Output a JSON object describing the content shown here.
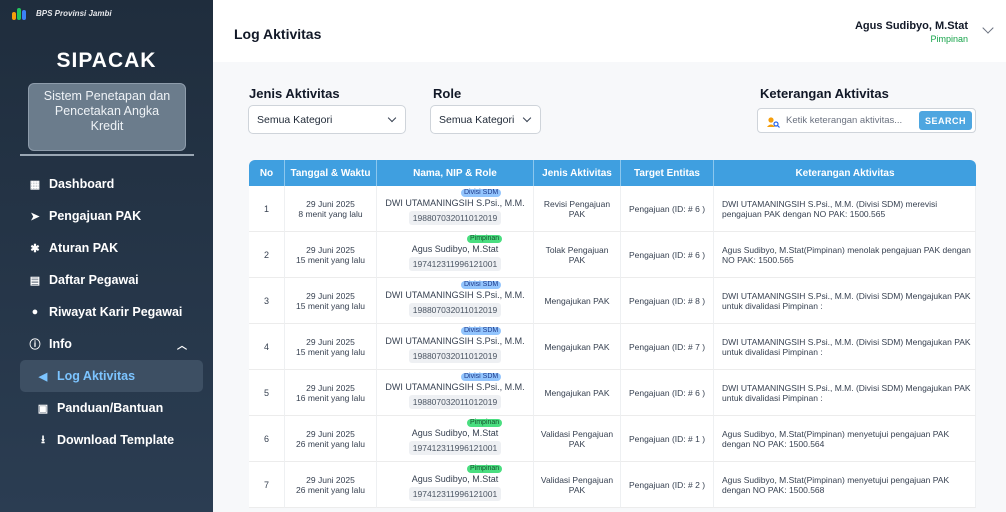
{
  "sidebar": {
    "org_name": "BPS Provinsi Jambi",
    "app_title": "SIPACAK",
    "app_subtitle": "Sistem Penetapan dan Pencetakan Angka Kredit",
    "items": [
      {
        "label": "Dashboard",
        "icon": "grid-icon"
      },
      {
        "label": "Pengajuan PAK",
        "icon": "send-icon"
      },
      {
        "label": "Aturan PAK",
        "icon": "gear-icon"
      },
      {
        "label": "Daftar Pegawai",
        "icon": "list-icon"
      },
      {
        "label": "Riwayat Karir Pegawai",
        "icon": "users-icon"
      },
      {
        "label": "Info",
        "icon": "info-icon"
      },
      {
        "label": "Log Aktivitas",
        "icon": "megaphone-icon"
      },
      {
        "label": "Panduan/Bantuan",
        "icon": "book-icon"
      },
      {
        "label": "Download Template",
        "icon": "download-icon"
      }
    ]
  },
  "header": {
    "page_title": "Log Aktivitas",
    "user_name": "Agus Sudibyo, M.Stat",
    "user_role": "Pimpinan"
  },
  "filters": {
    "jenis_label": "Jenis Aktivitas",
    "jenis_value": "Semua Kategori",
    "role_label": "Role",
    "role_value": "Semua Kategori",
    "ket_label": "Keterangan Aktivitas",
    "search_placeholder": "Ketik keterangan aktivitas...",
    "search_button": "SEARCH"
  },
  "table": {
    "headers": [
      "No",
      "Tanggal & Waktu",
      "Nama, NIP & Role",
      "Jenis Aktivitas",
      "Target Entitas",
      "Keterangan Aktivitas"
    ],
    "rows": [
      {
        "no": "1",
        "date": "29 Juni 2025",
        "ago": "8 menit yang lalu",
        "name": "DWI UTAMANINGSIH S.Psi., M.M.",
        "role": "Divisi SDM",
        "nip": "198807032011012019",
        "jenis": "Revisi Pengajuan PAK",
        "target": "Pengajuan (ID: # 6 )",
        "ket": "DWI UTAMANINGSIH S.Psi., M.M. (Divisi SDM) merevisi pengajuan PAK dengan NO PAK: 1500.565"
      },
      {
        "no": "2",
        "date": "29 Juni 2025",
        "ago": "15 menit yang lalu",
        "name": "Agus Sudibyo, M.Stat",
        "role": "Pimpinan",
        "nip": "197412311996121001",
        "jenis": "Tolak Pengajuan PAK",
        "target": "Pengajuan (ID: # 6 )",
        "ket": "Agus Sudibyo, M.Stat(Pimpinan) menolak pengajuan PAK dengan NO PAK: 1500.565"
      },
      {
        "no": "3",
        "date": "29 Juni 2025",
        "ago": "15 menit yang lalu",
        "name": "DWI UTAMANINGSIH S.Psi., M.M.",
        "role": "Divisi SDM",
        "nip": "198807032011012019",
        "jenis": "Mengajukan PAK",
        "target": "Pengajuan (ID: # 8 )",
        "ket": "DWI UTAMANINGSIH S.Psi., M.M. (Divisi SDM) Mengajukan PAK untuk divalidasi Pimpinan :"
      },
      {
        "no": "4",
        "date": "29 Juni 2025",
        "ago": "15 menit yang lalu",
        "name": "DWI UTAMANINGSIH S.Psi., M.M.",
        "role": "Divisi SDM",
        "nip": "198807032011012019",
        "jenis": "Mengajukan PAK",
        "target": "Pengajuan (ID: # 7 )",
        "ket": "DWI UTAMANINGSIH S.Psi., M.M. (Divisi SDM) Mengajukan PAK untuk divalidasi Pimpinan :"
      },
      {
        "no": "5",
        "date": "29 Juni 2025",
        "ago": "16 menit yang lalu",
        "name": "DWI UTAMANINGSIH S.Psi., M.M.",
        "role": "Divisi SDM",
        "nip": "198807032011012019",
        "jenis": "Mengajukan PAK",
        "target": "Pengajuan (ID: # 6 )",
        "ket": "DWI UTAMANINGSIH S.Psi., M.M. (Divisi SDM) Mengajukan PAK untuk divalidasi Pimpinan :"
      },
      {
        "no": "6",
        "date": "29 Juni 2025",
        "ago": "26 menit yang lalu",
        "name": "Agus Sudibyo, M.Stat",
        "role": "Pimpinan",
        "nip": "197412311996121001",
        "jenis": "Validasi Pengajuan PAK",
        "target": "Pengajuan (ID: # 1 )",
        "ket": "Agus Sudibyo, M.Stat(Pimpinan) menyetujui pengajuan PAK dengan NO PAK: 1500.564"
      },
      {
        "no": "7",
        "date": "29 Juni 2025",
        "ago": "26 menit yang lalu",
        "name": "Agus Sudibyo, M.Stat",
        "role": "Pimpinan",
        "nip": "197412311996121001",
        "jenis": "Validasi Pengajuan PAK",
        "target": "Pengajuan (ID: # 2 )",
        "ket": "Agus Sudibyo, M.Stat(Pimpinan) menyetujui pengajuan PAK dengan NO PAK: 1500.568"
      }
    ]
  }
}
